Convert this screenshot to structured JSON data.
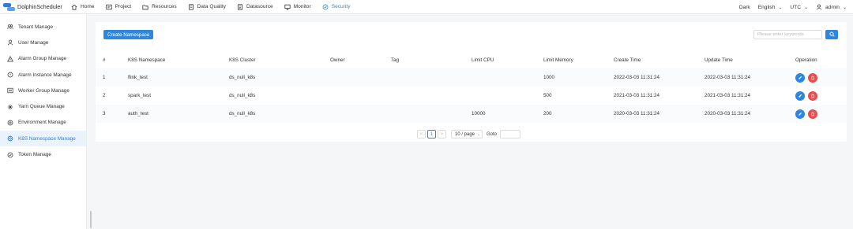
{
  "app": {
    "name": "DolphinScheduler"
  },
  "nav": [
    {
      "label": "Home",
      "icon": "home-icon"
    },
    {
      "label": "Project",
      "icon": "project-icon"
    },
    {
      "label": "Resources",
      "icon": "folder-icon"
    },
    {
      "label": "Data Quality",
      "icon": "data-quality-icon"
    },
    {
      "label": "Datasource",
      "icon": "datasource-icon"
    },
    {
      "label": "Monitor",
      "icon": "monitor-icon"
    },
    {
      "label": "Security",
      "icon": "security-icon"
    }
  ],
  "top_right": {
    "theme": "Dark",
    "language": "English",
    "timezone": "UTC",
    "user": "admin"
  },
  "sidebar": {
    "items": [
      {
        "label": "Tenant Manage",
        "icon": "tenant-icon"
      },
      {
        "label": "User Manage",
        "icon": "user-icon"
      },
      {
        "label": "Alarm Group Manage",
        "icon": "alarm-group-icon"
      },
      {
        "label": "Alarm Instance Manage",
        "icon": "alarm-instance-icon"
      },
      {
        "label": "Worker Group Manage",
        "icon": "worker-group-icon"
      },
      {
        "label": "Yarn Queue Manage",
        "icon": "yarn-queue-icon"
      },
      {
        "label": "Environment Manage",
        "icon": "environment-icon"
      },
      {
        "label": "K8S Namespace Manage",
        "icon": "k8s-namespace-icon"
      },
      {
        "label": "Token Manage",
        "icon": "token-icon"
      }
    ],
    "active": "K8S Namespace Manage"
  },
  "toolbar": {
    "create_label": "Create Namespace",
    "search_placeholder": "Please enter keywords"
  },
  "table": {
    "columns": [
      "#",
      "K8S Namespace",
      "K8S Cluster",
      "Owner",
      "Tag",
      "Limit CPU",
      "Limit Memory",
      "Create Time",
      "Update Time",
      "Operation"
    ],
    "rows": [
      {
        "index": "1",
        "namespace": "flink_test",
        "cluster": "ds_null_k8s",
        "owner": "",
        "tag": "",
        "limit_cpu": "",
        "limit_memory": "1000",
        "create_time": "2022-03-03 11:31:24",
        "update_time": "2022-03-03 11:31:24"
      },
      {
        "index": "2",
        "namespace": "spark_test",
        "cluster": "ds_null_k8s",
        "owner": "",
        "tag": "",
        "limit_cpu": "",
        "limit_memory": "500",
        "create_time": "2021-03-03 11:31:24",
        "update_time": "2021-03-03 11:31:24"
      },
      {
        "index": "3",
        "namespace": "auth_test",
        "cluster": "ds_null_k8s",
        "owner": "",
        "tag": "",
        "limit_cpu": "10000",
        "limit_memory": "200",
        "create_time": "2020-03-03 11:31:24",
        "update_time": "2020-03-03 11:31:24"
      }
    ]
  },
  "pagination": {
    "prev": "<",
    "current_page": "1",
    "next": ">",
    "page_size": "10 / page",
    "goto_label": "Goto"
  },
  "colors": {
    "accent": "#2e86de",
    "danger": "#ea4c4c",
    "active_bg": "#e9f2fd"
  }
}
